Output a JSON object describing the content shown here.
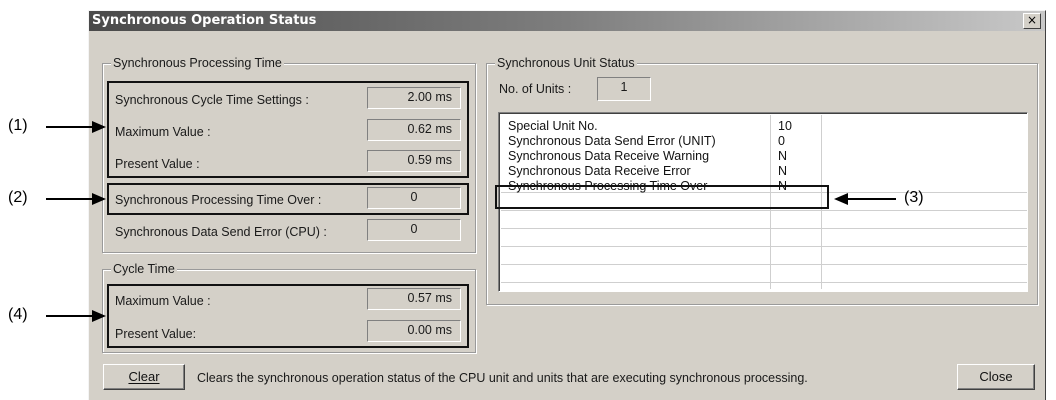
{
  "window": {
    "title": "Synchronous Operation Status",
    "close_glyph": "×"
  },
  "processing_time": {
    "legend": "Synchronous Processing Time",
    "rows": [
      {
        "label": "Synchronous Cycle Time Settings :",
        "value": "2.00 ms"
      },
      {
        "label": "Maximum Value :",
        "value": "0.62 ms"
      },
      {
        "label": "Present Value :",
        "value": "0.59 ms"
      },
      {
        "label": "Synchronous Processing Time Over :",
        "value": "0"
      },
      {
        "label": "Synchronous Data Send Error (CPU) :",
        "value": "0"
      }
    ]
  },
  "cycle_time": {
    "legend": "Cycle Time",
    "rows": [
      {
        "label": "Maximum Value :",
        "value": "0.57 ms"
      },
      {
        "label": "Present Value:",
        "value": "0.00 ms"
      }
    ]
  },
  "unit_status": {
    "legend": "Synchronous Unit Status",
    "units_label": "No. of Units :",
    "units_value": "1",
    "rows": [
      {
        "name": "Special Unit No.",
        "value": "10"
      },
      {
        "name": "Synchronous Data Send Error (UNIT)",
        "value": "0"
      },
      {
        "name": "Synchronous Data Receive Warning",
        "value": "N"
      },
      {
        "name": "Synchronous Data Receive Error",
        "value": "N"
      },
      {
        "name": "Synchronous Processing Time Over",
        "value": "N"
      }
    ]
  },
  "footer": {
    "clear_label": "Clear",
    "description": "Clears the synchronous operation status of the CPU unit and units that are executing synchronous processing.",
    "close_label": "Close"
  },
  "callouts": {
    "c1": "(1)",
    "c2": "(2)",
    "c3": "(3)",
    "c4": "(4)"
  }
}
